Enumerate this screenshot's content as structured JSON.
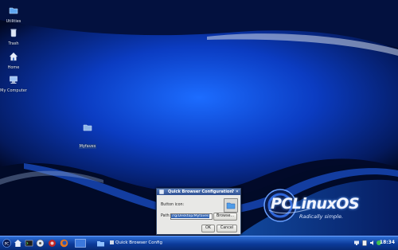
{
  "desktop": {
    "icons": [
      {
        "label": "Utilities",
        "icon": "folder-icon"
      },
      {
        "label": "Trash",
        "icon": "trash-icon"
      },
      {
        "label": "Home",
        "icon": "home-icon"
      },
      {
        "label": "My Computer",
        "icon": "computer-icon"
      },
      {
        "label": "Myfaves",
        "icon": "folder-icon"
      }
    ]
  },
  "branding": {
    "title": "PCLinuxOS",
    "tagline": "Radically simple."
  },
  "dialog": {
    "title": "Quick Browser Configuration",
    "button_icon_label": "Button icon:",
    "path_label": "Path:",
    "path_value": "/rg/Desktop/Myfaves",
    "browse_label": "Browse...",
    "ok_label": "OK",
    "cancel_label": "Cancel"
  },
  "taskbar": {
    "task_label": "Quick Browser Config",
    "clock": "18:34",
    "accent": "#1d57c4"
  }
}
